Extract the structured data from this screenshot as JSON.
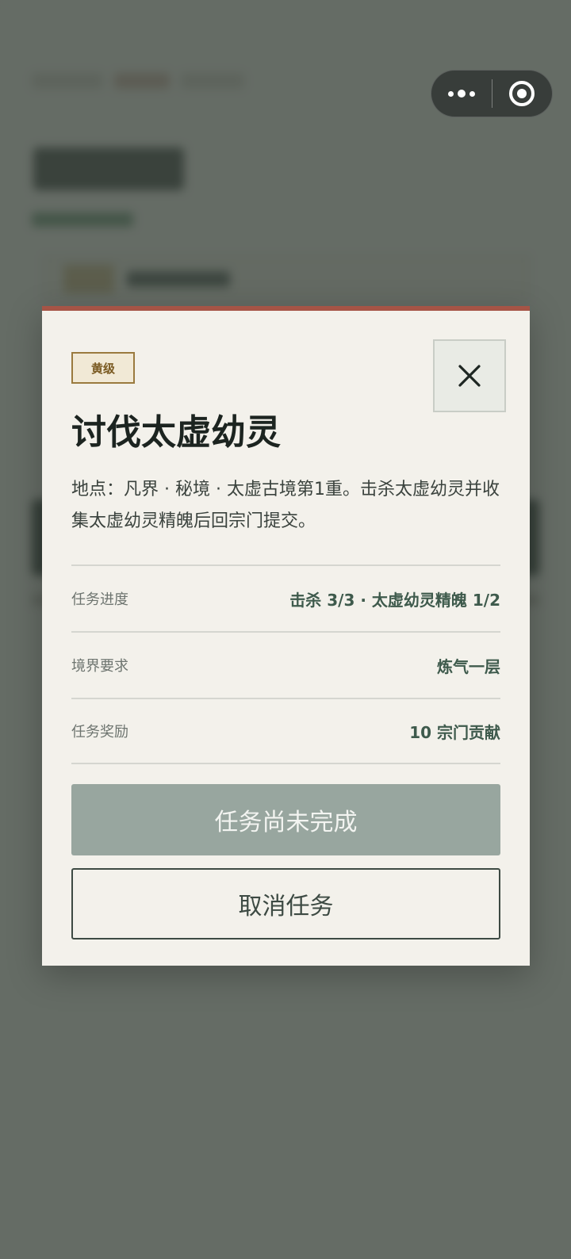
{
  "capsule": {
    "more_icon": "more-dots-icon",
    "close_icon": "target-circle-icon"
  },
  "modal": {
    "accent_color": "#a65446",
    "badge": "黄级",
    "title": "讨伐太虚幼灵",
    "description": "地点：凡界 · 秘境 · 太虚古境第1重。击杀太虚幼灵并收集太虚幼灵精魄后回宗门提交。",
    "close_icon": "close-x-icon",
    "rows": [
      {
        "label": "任务进度",
        "value": "击杀 3/3 · 太虚幼灵精魄 1/2"
      },
      {
        "label": "境界要求",
        "value": "炼气一层"
      },
      {
        "label": "任务奖励",
        "value": "10 宗门贡献"
      }
    ],
    "primary_button": "任务尚未完成",
    "secondary_button": "取消任务"
  }
}
